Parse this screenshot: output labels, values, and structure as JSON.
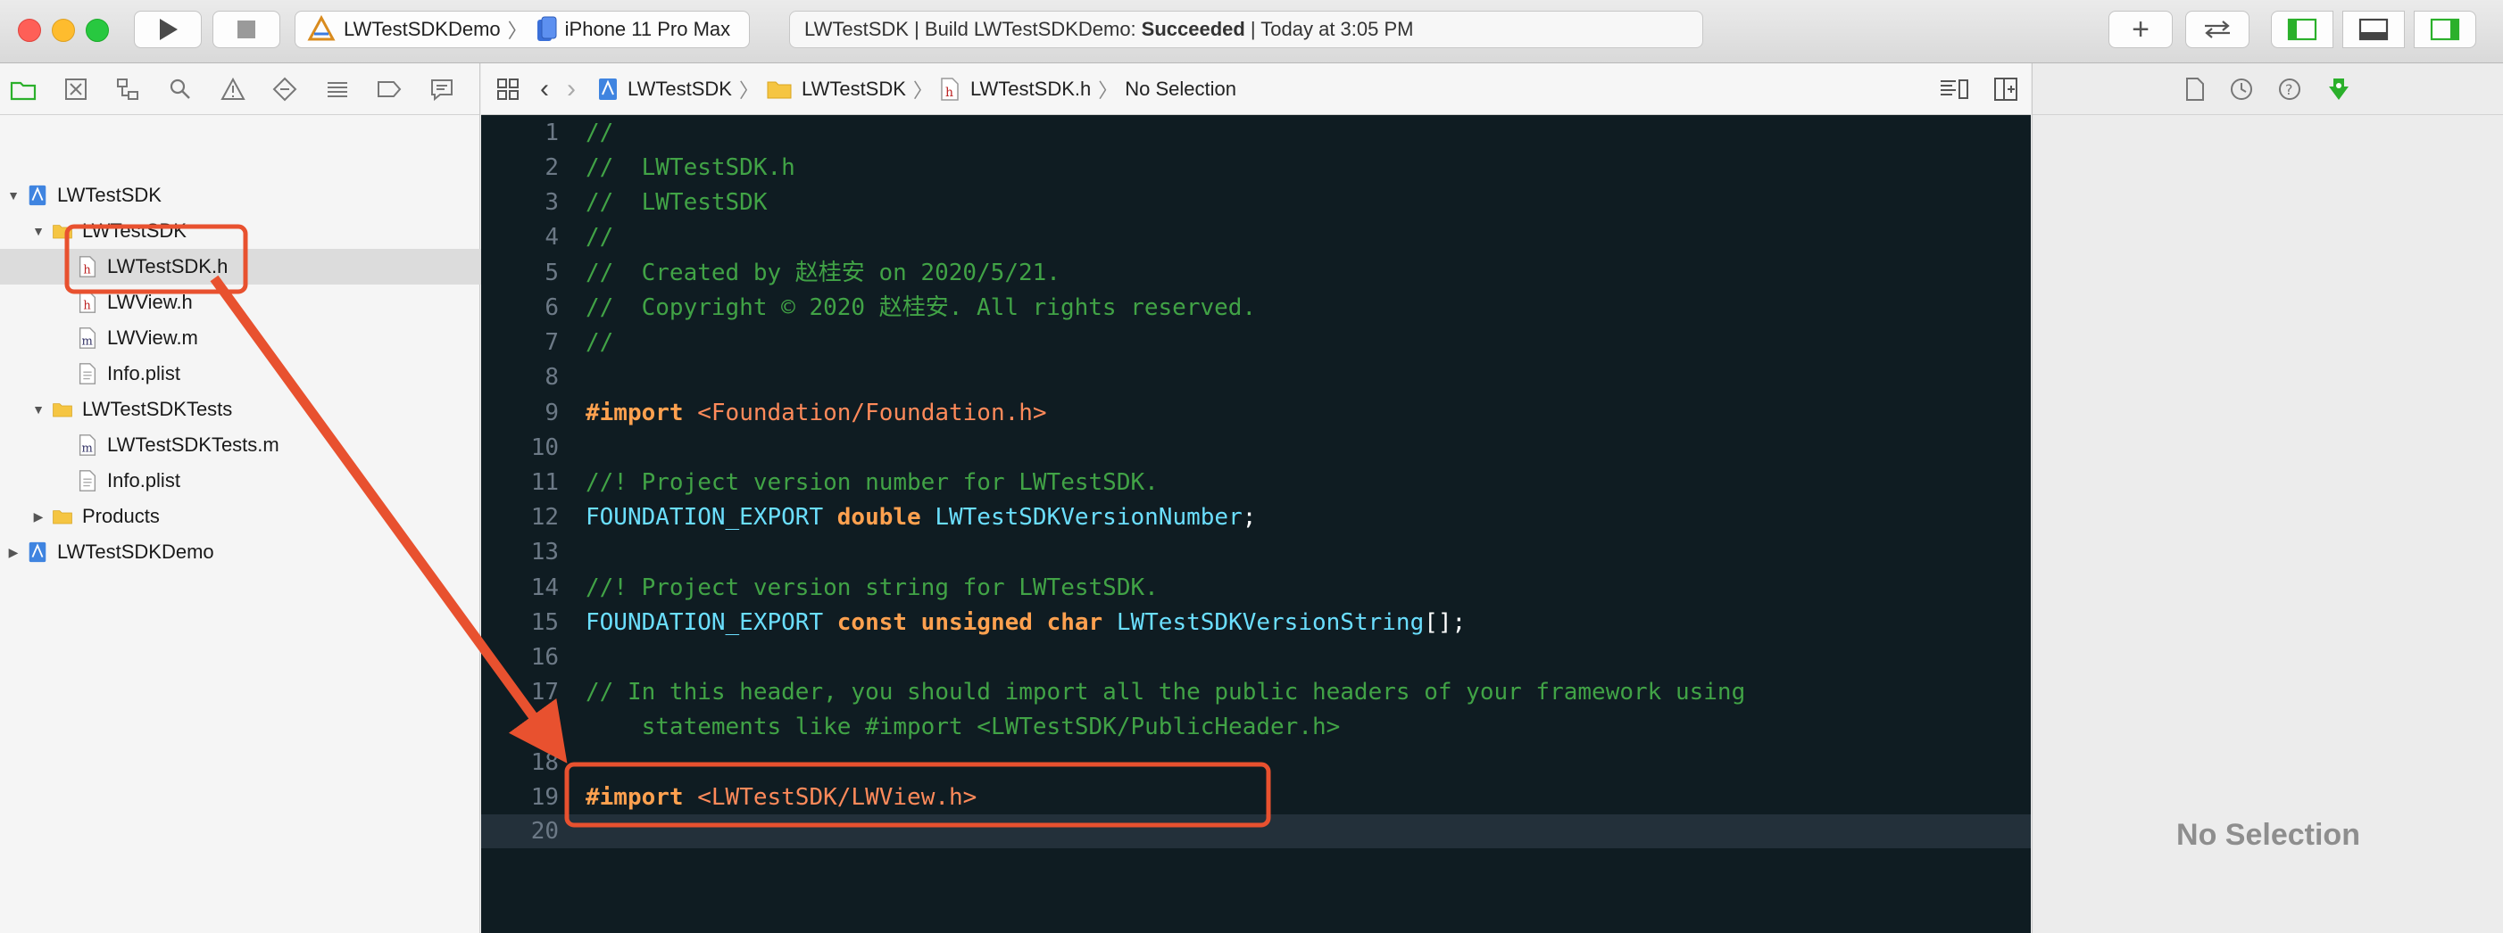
{
  "toolbar": {
    "scheme": "LWTestSDKDemo",
    "device": "iPhone 11 Pro Max",
    "activity_prefix": "LWTestSDK | Build LWTestSDKDemo:",
    "activity_status": "Succeeded",
    "activity_suffix": "| Today at 3:05 PM"
  },
  "navigator": {
    "items": [
      {
        "label": "LWTestSDK",
        "type": "project"
      },
      {
        "label": "LWTestSDK",
        "type": "folder"
      },
      {
        "label": "LWTestSDK.h",
        "type": "h"
      },
      {
        "label": "LWView.h",
        "type": "h"
      },
      {
        "label": "LWView.m",
        "type": "m"
      },
      {
        "label": "Info.plist",
        "type": "plist"
      },
      {
        "label": "LWTestSDKTests",
        "type": "folder"
      },
      {
        "label": "LWTestSDKTests.m",
        "type": "m"
      },
      {
        "label": "Info.plist",
        "type": "plist"
      },
      {
        "label": "Products",
        "type": "folder"
      },
      {
        "label": "LWTestSDKDemo",
        "type": "project"
      }
    ]
  },
  "jumpbar": {
    "crumbs": [
      "LWTestSDK",
      "LWTestSDK",
      "LWTestSDK.h",
      "No Selection"
    ]
  },
  "editor": {
    "lines": [
      {
        "n": "1",
        "text": "//"
      },
      {
        "n": "2",
        "text": "//  LWTestSDK.h"
      },
      {
        "n": "3",
        "text": "//  LWTestSDK"
      },
      {
        "n": "4",
        "text": "//"
      },
      {
        "n": "5",
        "text": "//  Created by 赵桂安 on 2020/5/21."
      },
      {
        "n": "6",
        "text": "//  Copyright © 2020 赵桂安. All rights reserved."
      },
      {
        "n": "7",
        "text": "//"
      },
      {
        "n": "8",
        "text": ""
      },
      {
        "n": "9",
        "kw": "#import",
        "str": "<Foundation/Foundation.h>"
      },
      {
        "n": "10",
        "text": ""
      },
      {
        "n": "11",
        "text": "//! Project version number for LWTestSDK."
      },
      {
        "n": "12",
        "typ": "FOUNDATION_EXPORT",
        "kw": "double",
        "name": "LWTestSDKVersionNumber",
        "tail": ";"
      },
      {
        "n": "13",
        "text": ""
      },
      {
        "n": "14",
        "text": "//! Project version string for LWTestSDK."
      },
      {
        "n": "15",
        "typ": "FOUNDATION_EXPORT",
        "kw": "const unsigned char",
        "name": "LWTestSDKVersionString",
        "tail": "[];"
      },
      {
        "n": "16",
        "text": ""
      },
      {
        "n": "17",
        "text": "// In this header, you should import all the public headers of your framework using"
      },
      {
        "n": "",
        "text": "    statements like #import <LWTestSDK/PublicHeader.h>"
      },
      {
        "n": "18",
        "text": ""
      },
      {
        "n": "19",
        "kw": "#import",
        "str": "<LWTestSDK/LWView.h>"
      },
      {
        "n": "20",
        "text": ""
      }
    ]
  },
  "inspector": {
    "empty_label": "No Selection"
  },
  "colors": {
    "annotation": "#e8512f",
    "editor_bg": "#0f1c22",
    "comment": "#41a346",
    "keyword": "#ffa14f",
    "string": "#ff8a5a",
    "type": "#6bdfff"
  },
  "icons": [
    "play-icon",
    "stop-icon",
    "app-icon",
    "device-icon",
    "add-icon",
    "swap-icon",
    "left-panel-icon",
    "bottom-panel-icon",
    "right-panel-icon"
  ]
}
